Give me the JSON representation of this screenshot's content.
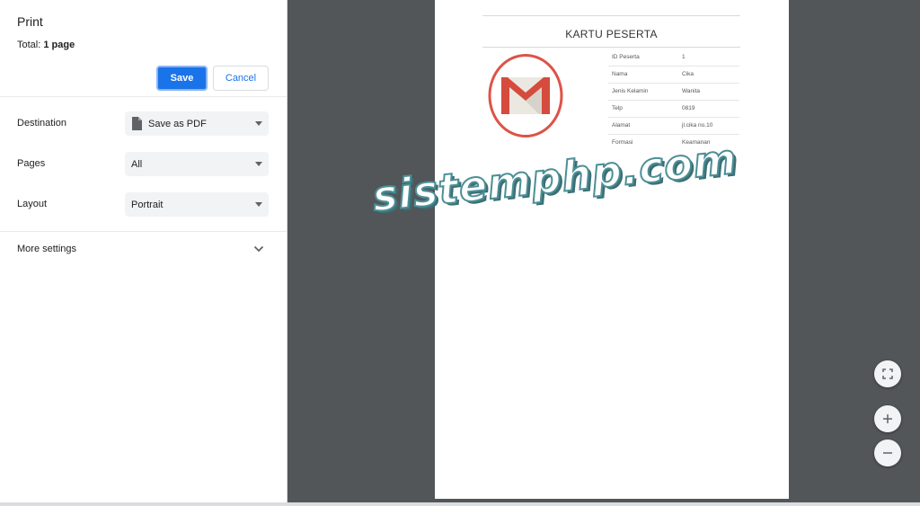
{
  "dialog": {
    "title": "Print",
    "total_label": "Total: ",
    "total_value": "1 page",
    "save_label": "Save",
    "cancel_label": "Cancel",
    "destination": {
      "label": "Destination",
      "value": "Save as PDF",
      "icon": "document-icon"
    },
    "pages": {
      "label": "Pages",
      "value": "All"
    },
    "layout": {
      "label": "Layout",
      "value": "Portrait"
    },
    "more_settings": {
      "label": "More settings",
      "icon": "chevron-down-icon"
    },
    "accent_color": "#1a73e8"
  },
  "preview": {
    "card_title": "KARTU PESERTA",
    "logo_icon": "gmail-logo",
    "rows": [
      {
        "key": "ID Peserta",
        "value": "1"
      },
      {
        "key": "Nama",
        "value": "Cika"
      },
      {
        "key": "Jenis Kelamin",
        "value": "Wanita"
      },
      {
        "key": "Telp",
        "value": "0819"
      },
      {
        "key": "Alamat",
        "value": "jl.cika no.10"
      },
      {
        "key": "Formasi",
        "value": "Keamanan"
      }
    ],
    "watermark": "sistemphp.com",
    "background_color": "#525659"
  },
  "controls": {
    "fit_icon": "fit-to-page-icon",
    "zoom_in_icon": "plus-icon",
    "zoom_out_icon": "minus-icon"
  }
}
